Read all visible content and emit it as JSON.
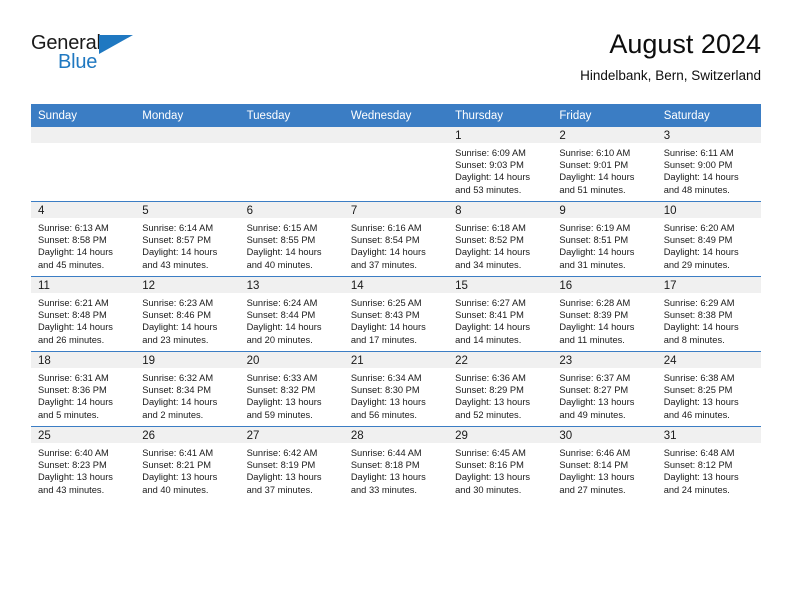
{
  "brand": {
    "name_part1": "General",
    "name_part2": "Blue",
    "accent_color": "#1f78c1"
  },
  "header": {
    "title": "August 2024",
    "subtitle": "Hindelbank, Bern, Switzerland"
  },
  "calendar": {
    "header_color": "#3b7dc4",
    "weekdays": [
      "Sunday",
      "Monday",
      "Tuesday",
      "Wednesday",
      "Thursday",
      "Friday",
      "Saturday"
    ],
    "weeks": [
      [
        {
          "day": "",
          "lines": []
        },
        {
          "day": "",
          "lines": []
        },
        {
          "day": "",
          "lines": []
        },
        {
          "day": "",
          "lines": []
        },
        {
          "day": "1",
          "lines": [
            "Sunrise: 6:09 AM",
            "Sunset: 9:03 PM",
            "Daylight: 14 hours",
            "and 53 minutes."
          ]
        },
        {
          "day": "2",
          "lines": [
            "Sunrise: 6:10 AM",
            "Sunset: 9:01 PM",
            "Daylight: 14 hours",
            "and 51 minutes."
          ]
        },
        {
          "day": "3",
          "lines": [
            "Sunrise: 6:11 AM",
            "Sunset: 9:00 PM",
            "Daylight: 14 hours",
            "and 48 minutes."
          ]
        }
      ],
      [
        {
          "day": "4",
          "lines": [
            "Sunrise: 6:13 AM",
            "Sunset: 8:58 PM",
            "Daylight: 14 hours",
            "and 45 minutes."
          ]
        },
        {
          "day": "5",
          "lines": [
            "Sunrise: 6:14 AM",
            "Sunset: 8:57 PM",
            "Daylight: 14 hours",
            "and 43 minutes."
          ]
        },
        {
          "day": "6",
          "lines": [
            "Sunrise: 6:15 AM",
            "Sunset: 8:55 PM",
            "Daylight: 14 hours",
            "and 40 minutes."
          ]
        },
        {
          "day": "7",
          "lines": [
            "Sunrise: 6:16 AM",
            "Sunset: 8:54 PM",
            "Daylight: 14 hours",
            "and 37 minutes."
          ]
        },
        {
          "day": "8",
          "lines": [
            "Sunrise: 6:18 AM",
            "Sunset: 8:52 PM",
            "Daylight: 14 hours",
            "and 34 minutes."
          ]
        },
        {
          "day": "9",
          "lines": [
            "Sunrise: 6:19 AM",
            "Sunset: 8:51 PM",
            "Daylight: 14 hours",
            "and 31 minutes."
          ]
        },
        {
          "day": "10",
          "lines": [
            "Sunrise: 6:20 AM",
            "Sunset: 8:49 PM",
            "Daylight: 14 hours",
            "and 29 minutes."
          ]
        }
      ],
      [
        {
          "day": "11",
          "lines": [
            "Sunrise: 6:21 AM",
            "Sunset: 8:48 PM",
            "Daylight: 14 hours",
            "and 26 minutes."
          ]
        },
        {
          "day": "12",
          "lines": [
            "Sunrise: 6:23 AM",
            "Sunset: 8:46 PM",
            "Daylight: 14 hours",
            "and 23 minutes."
          ]
        },
        {
          "day": "13",
          "lines": [
            "Sunrise: 6:24 AM",
            "Sunset: 8:44 PM",
            "Daylight: 14 hours",
            "and 20 minutes."
          ]
        },
        {
          "day": "14",
          "lines": [
            "Sunrise: 6:25 AM",
            "Sunset: 8:43 PM",
            "Daylight: 14 hours",
            "and 17 minutes."
          ]
        },
        {
          "day": "15",
          "lines": [
            "Sunrise: 6:27 AM",
            "Sunset: 8:41 PM",
            "Daylight: 14 hours",
            "and 14 minutes."
          ]
        },
        {
          "day": "16",
          "lines": [
            "Sunrise: 6:28 AM",
            "Sunset: 8:39 PM",
            "Daylight: 14 hours",
            "and 11 minutes."
          ]
        },
        {
          "day": "17",
          "lines": [
            "Sunrise: 6:29 AM",
            "Sunset: 8:38 PM",
            "Daylight: 14 hours",
            "and 8 minutes."
          ]
        }
      ],
      [
        {
          "day": "18",
          "lines": [
            "Sunrise: 6:31 AM",
            "Sunset: 8:36 PM",
            "Daylight: 14 hours",
            "and 5 minutes."
          ]
        },
        {
          "day": "19",
          "lines": [
            "Sunrise: 6:32 AM",
            "Sunset: 8:34 PM",
            "Daylight: 14 hours",
            "and 2 minutes."
          ]
        },
        {
          "day": "20",
          "lines": [
            "Sunrise: 6:33 AM",
            "Sunset: 8:32 PM",
            "Daylight: 13 hours",
            "and 59 minutes."
          ]
        },
        {
          "day": "21",
          "lines": [
            "Sunrise: 6:34 AM",
            "Sunset: 8:30 PM",
            "Daylight: 13 hours",
            "and 56 minutes."
          ]
        },
        {
          "day": "22",
          "lines": [
            "Sunrise: 6:36 AM",
            "Sunset: 8:29 PM",
            "Daylight: 13 hours",
            "and 52 minutes."
          ]
        },
        {
          "day": "23",
          "lines": [
            "Sunrise: 6:37 AM",
            "Sunset: 8:27 PM",
            "Daylight: 13 hours",
            "and 49 minutes."
          ]
        },
        {
          "day": "24",
          "lines": [
            "Sunrise: 6:38 AM",
            "Sunset: 8:25 PM",
            "Daylight: 13 hours",
            "and 46 minutes."
          ]
        }
      ],
      [
        {
          "day": "25",
          "lines": [
            "Sunrise: 6:40 AM",
            "Sunset: 8:23 PM",
            "Daylight: 13 hours",
            "and 43 minutes."
          ]
        },
        {
          "day": "26",
          "lines": [
            "Sunrise: 6:41 AM",
            "Sunset: 8:21 PM",
            "Daylight: 13 hours",
            "and 40 minutes."
          ]
        },
        {
          "day": "27",
          "lines": [
            "Sunrise: 6:42 AM",
            "Sunset: 8:19 PM",
            "Daylight: 13 hours",
            "and 37 minutes."
          ]
        },
        {
          "day": "28",
          "lines": [
            "Sunrise: 6:44 AM",
            "Sunset: 8:18 PM",
            "Daylight: 13 hours",
            "and 33 minutes."
          ]
        },
        {
          "day": "29",
          "lines": [
            "Sunrise: 6:45 AM",
            "Sunset: 8:16 PM",
            "Daylight: 13 hours",
            "and 30 minutes."
          ]
        },
        {
          "day": "30",
          "lines": [
            "Sunrise: 6:46 AM",
            "Sunset: 8:14 PM",
            "Daylight: 13 hours",
            "and 27 minutes."
          ]
        },
        {
          "day": "31",
          "lines": [
            "Sunrise: 6:48 AM",
            "Sunset: 8:12 PM",
            "Daylight: 13 hours",
            "and 24 minutes."
          ]
        }
      ]
    ]
  }
}
